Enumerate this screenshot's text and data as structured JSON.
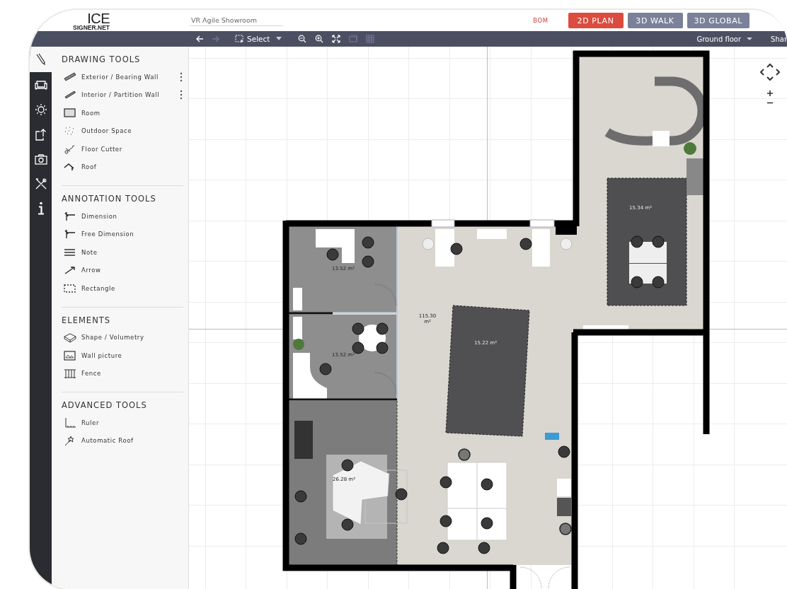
{
  "logo": {
    "line_1": "ICE",
    "line_2": "SIGNER.NET"
  },
  "project_title": "VR Agile Showroom",
  "bom_link": "BOM",
  "views": [
    {
      "label": "2D PLAN",
      "selected": true
    },
    {
      "label": "3D WALK",
      "selected": false
    },
    {
      "label": "3D GLOBAL",
      "selected": false
    }
  ],
  "toolbar": {
    "history": [
      {
        "disabled": false
      },
      {
        "disabled": true
      }
    ],
    "select_label": "Select",
    "view_tools": [
      {
        "disabled": false
      },
      {
        "disabled": false
      },
      {
        "disabled": false
      },
      {
        "disabled": true
      },
      {
        "disabled": true
      }
    ],
    "floor_selector": "Ground floor",
    "share_label": "Shar"
  },
  "rail": [
    {
      "selected": true
    },
    {
      "selected": false
    },
    {
      "selected": false
    },
    {
      "selected": false
    },
    {
      "selected": false
    },
    {
      "selected": false
    },
    {
      "selected": false
    }
  ],
  "panel": {
    "sections": [
      {
        "title": "DRAWING TOOLS",
        "items": [
          {
            "label": "Exterior / Bearing Wall",
            "has_menu": true
          },
          {
            "label": "Interior / Partition Wall",
            "has_menu": true
          },
          {
            "label": "Room",
            "has_menu": false
          },
          {
            "label": "Outdoor Space",
            "has_menu": false
          },
          {
            "label": "Floor Cutter",
            "has_menu": false
          },
          {
            "label": "Roof",
            "has_menu": false
          }
        ]
      },
      {
        "title": "ANNOTATION TOOLS",
        "items": [
          {
            "label": "Dimension",
            "has_menu": false
          },
          {
            "label": "Free Dimension",
            "has_menu": false
          },
          {
            "label": "Note",
            "has_menu": false
          },
          {
            "label": "Arrow",
            "has_menu": false
          },
          {
            "label": "Rectangle",
            "has_menu": false
          }
        ]
      },
      {
        "title": "ELEMENTS",
        "items": [
          {
            "label": "Shape / Volumetry",
            "has_menu": false
          },
          {
            "label": "Wall picture",
            "has_menu": false
          },
          {
            "label": "Fence",
            "has_menu": false
          }
        ]
      },
      {
        "title": "ADVANCED TOOLS",
        "items": [
          {
            "label": "Ruler",
            "has_menu": false
          },
          {
            "label": "Automatic Roof",
            "has_menu": false
          }
        ]
      }
    ]
  },
  "plan": {
    "area_labels": [
      "13.52 m²",
      "13.52 m²",
      "115.30 m²",
      "15.22 m²",
      "15.34 m²",
      "26.28 m²"
    ]
  }
}
